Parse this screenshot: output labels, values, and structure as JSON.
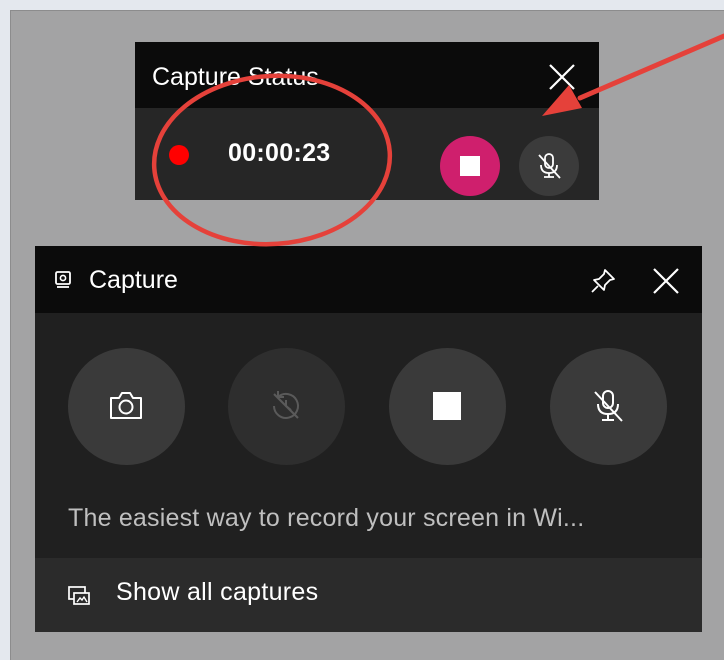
{
  "capture_status": {
    "title": "Capture Status",
    "timer": "00:00:23",
    "icons": {
      "close": "close-icon",
      "record": "recording-dot-icon",
      "stop": "stop-icon",
      "mic": "mic-off-icon"
    }
  },
  "capture": {
    "title": "Capture",
    "description": "The easiest way to record your screen in Wi...",
    "footer_label": "Show all captures",
    "buttons": [
      {
        "name": "screenshot",
        "icon": "camera-icon"
      },
      {
        "name": "record-last-30",
        "icon": "record-last-icon"
      },
      {
        "name": "stop-recording",
        "icon": "stop-icon"
      },
      {
        "name": "mic",
        "icon": "mic-off-icon"
      }
    ]
  },
  "colors": {
    "record_dot": "#ff0000",
    "stop_button": "#cf1f6d",
    "annotation": "#e5413a",
    "header_bg": "#0b0b0b",
    "panel_bg": "#202020"
  }
}
